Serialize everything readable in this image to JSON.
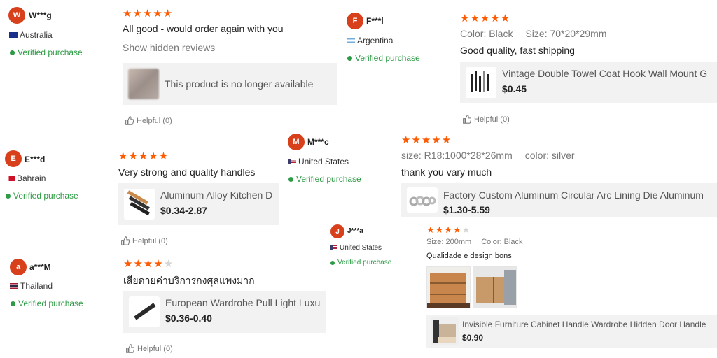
{
  "accent_color": "#d8401c",
  "star_color": "#ff5a00",
  "verified_color": "#2e9b46",
  "reviews": [
    {
      "avatar": "W",
      "user": "W***g",
      "country": "Australia",
      "verified": "Verified purchase",
      "rating": 5,
      "comment": "All good - would order again with you",
      "show_hidden": "Show hidden reviews",
      "product_unavailable": "This product is no longer available",
      "helpful": "Helpful (0)"
    },
    {
      "avatar": "F",
      "user": "F***l",
      "country": "Argentina",
      "verified": "Verified purchase",
      "rating": 5,
      "attr1": "Color: Black",
      "attr2": "Size: 70*20*29mm",
      "comment": "Good quality, fast shipping",
      "product_title": "Vintage Double Towel Coat Hook Wall Mount G",
      "product_price": "$0.45",
      "helpful": "Helpful (0)"
    },
    {
      "avatar": "E",
      "user": "E***d",
      "country": "Bahrain",
      "verified": "Verified purchase",
      "rating": 5,
      "comment": "Very strong and quality handles",
      "product_title": "Aluminum Alloy Kitchen D",
      "product_price": "$0.34-2.87",
      "helpful": "Helpful (0)"
    },
    {
      "avatar": "M",
      "user": "M***c",
      "country": "United States",
      "verified": "Verified purchase",
      "rating": 5,
      "attr1": "size: R18:1000*28*26mm",
      "attr2": "color: silver",
      "comment": "thank you vary much",
      "product_title": "Factory Custom Aluminum Circular Arc Lining Die Aluminum",
      "product_price": "$1.30-5.59"
    },
    {
      "avatar": "J",
      "user": "J***a",
      "country": "United States",
      "verified": "Verified purchase",
      "rating": 4,
      "attr1": "Size: 200mm",
      "attr2": "Color: Black",
      "comment": "Qualidade e design bons",
      "product_title": "Invisible Furniture Cabinet Handle Wardrobe Hidden Door Handle",
      "product_price": "$0.90"
    },
    {
      "avatar": "a",
      "user": "a***M",
      "country": "Thailand",
      "verified": "Verified purchase",
      "rating": 4,
      "comment": "เสียดายค่าบริการกงศุลแพงมาก",
      "product_title": "European Wardrobe Pull Light Luxu",
      "product_price": "$0.36-0.40",
      "helpful": "Helpful (0)"
    }
  ]
}
